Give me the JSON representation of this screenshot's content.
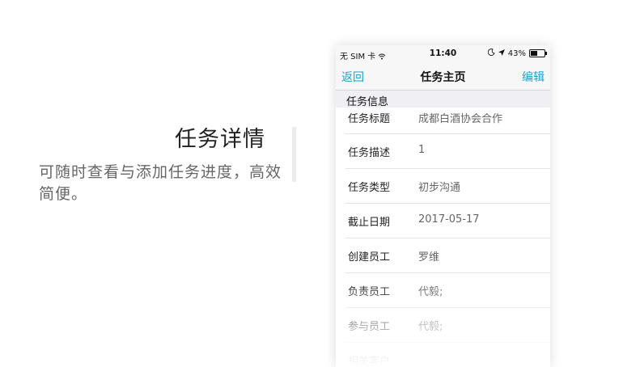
{
  "promo": {
    "title": "任务详情",
    "description": "可随时查看与添加任务进度，高效简便。"
  },
  "status_bar": {
    "carrier": "无 SIM 卡",
    "time": "11:40",
    "battery": "43%",
    "battery_level": 0.43
  },
  "nav": {
    "back_label": "返回",
    "title": "任务主页",
    "edit_label": "编辑"
  },
  "section": {
    "header": "任务信息",
    "rows": [
      {
        "label": "任务标题",
        "value": "成都白酒协会合作"
      },
      {
        "label": "任务描述",
        "value": "1"
      },
      {
        "label": "任务类型",
        "value": "初步沟通"
      },
      {
        "label": "截止日期",
        "value": "2017-05-17"
      },
      {
        "label": "创建员工",
        "value": "罗维"
      },
      {
        "label": "负责员工",
        "value": "代毅;"
      },
      {
        "label": "参与员工",
        "value": "代毅;"
      },
      {
        "label": "相关客户",
        "value": ""
      }
    ]
  }
}
